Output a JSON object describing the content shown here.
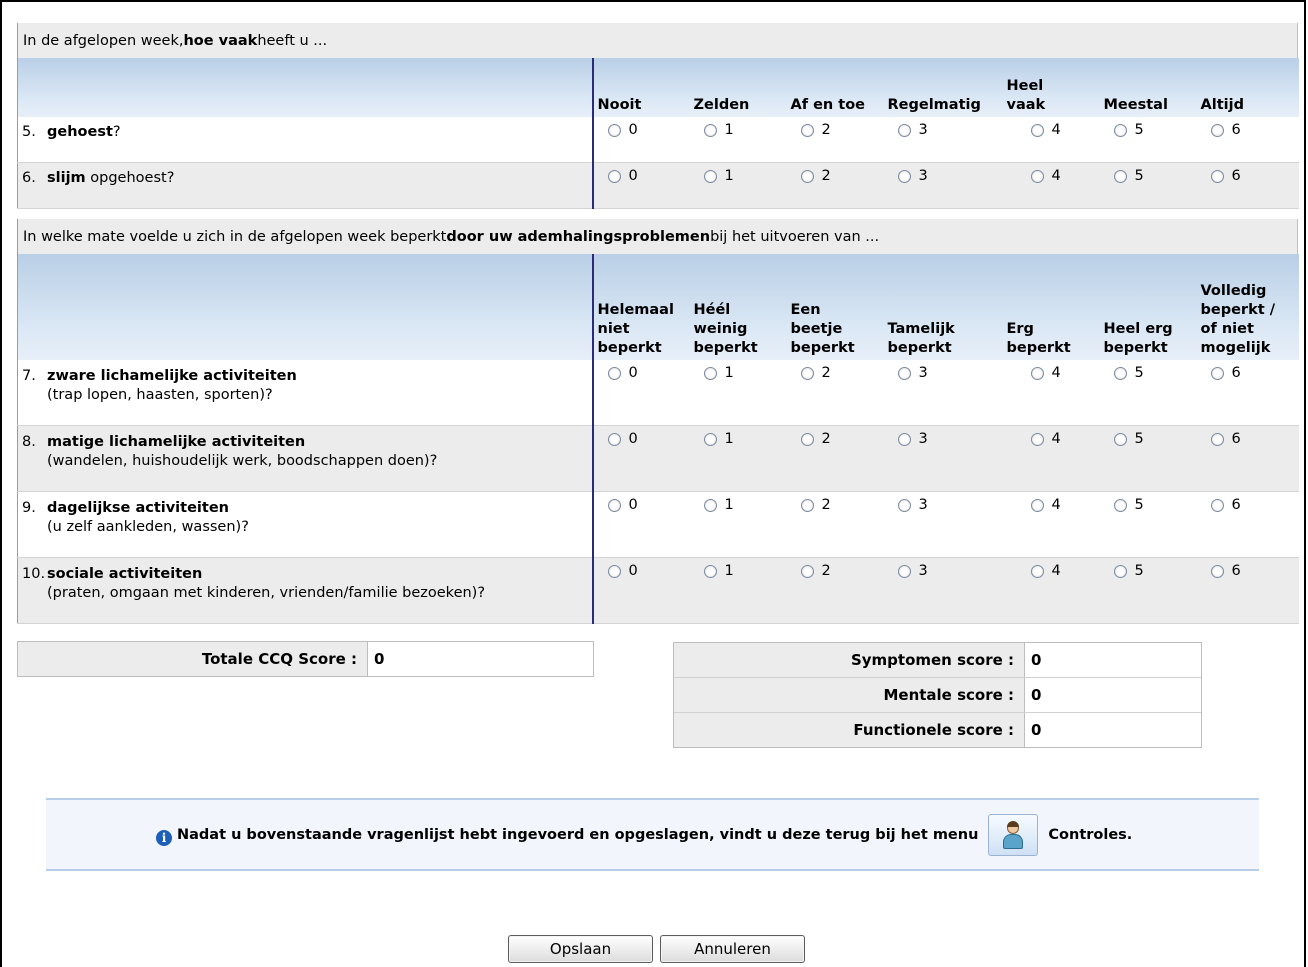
{
  "section1": {
    "title_pre": "In de afgelopen week, ",
    "title_bold": "hoe vaak",
    "title_post": " heeft u ...",
    "columns": [
      "Nooit",
      "Zelden",
      "Af en toe",
      "Regelmatig",
      "Heel\nvaak",
      "Meestal",
      "Altijd"
    ],
    "rows": [
      {
        "num": "5.",
        "bold": "gehoest",
        "rest": "?",
        "sub": ""
      },
      {
        "num": "6.",
        "bold": "slijm",
        "rest": " opgehoest?",
        "sub": ""
      }
    ]
  },
  "section2": {
    "title_pre": "In welke mate voelde u zich in de afgelopen week beperkt ",
    "title_bold": "door uw ademhalingsproblemen",
    "title_post": " bij het uitvoeren van ...",
    "columns": [
      "Helemaal\nniet\nbeperkt",
      "Héél\nweinig\nbeperkt",
      "Een\nbeetje\nbeperkt",
      "Tamelijk\nbeperkt",
      "Erg\nbeperkt",
      "Heel erg\nbeperkt",
      "Volledig\nbeperkt /\nof niet\nmogelijk"
    ],
    "rows": [
      {
        "num": "7.",
        "bold": "zware lichamelijke activiteiten",
        "rest": "",
        "sub": "(trap lopen, haasten, sporten)?"
      },
      {
        "num": "8.",
        "bold": "matige lichamelijke activiteiten",
        "rest": "",
        "sub": "(wandelen, huishoudelijk werk, boodschappen doen)?"
      },
      {
        "num": "9.",
        "bold": "dagelijkse activiteiten",
        "rest": "",
        "sub": "(u zelf aankleden, wassen)?"
      },
      {
        "num": "10.",
        "bold": "sociale activiteiten",
        "rest": "",
        "sub": "(praten, omgaan met kinderen, vrienden/familie bezoeken)?"
      }
    ]
  },
  "option_values": [
    "0",
    "1",
    "2",
    "3",
    "4",
    "5",
    "6"
  ],
  "scores": {
    "total_label": "Totale CCQ Score :",
    "total_value": "0",
    "symptoms_label": "Symptomen score :",
    "symptoms_value": "0",
    "mental_label": "Mentale score :",
    "mental_value": "0",
    "functional_label": "Functionele score :",
    "functional_value": "0"
  },
  "info": {
    "message": "Nadat u bovenstaande vragenlijst hebt ingevoerd en opgeslagen, vindt u deze terug bij het menu",
    "menu_label": "Controles.",
    "info_icon": "info-icon",
    "menu_icon": "person-icon"
  },
  "buttons": {
    "save": "Opslaan",
    "cancel": "Annuleren"
  }
}
